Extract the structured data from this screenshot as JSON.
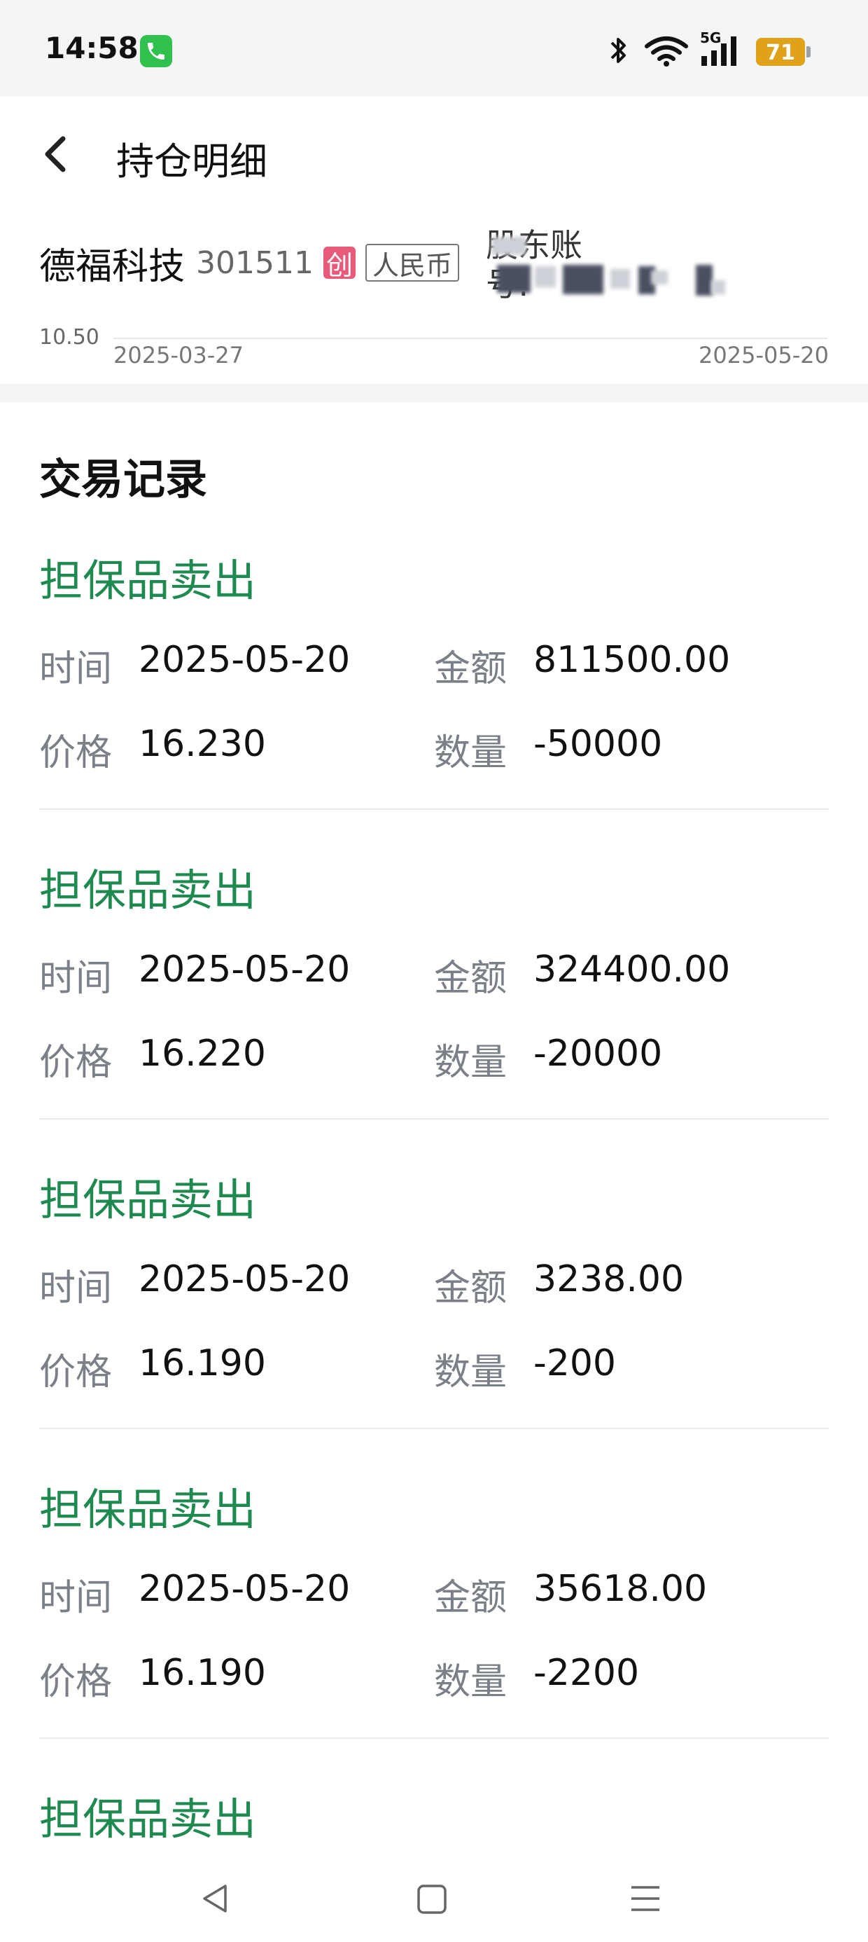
{
  "status_bar": {
    "time": "14:58",
    "network": "5G",
    "battery": "71"
  },
  "header": {
    "title": "持仓明细",
    "stock": {
      "name": "德福科技",
      "code": "301511",
      "board_badge": "创",
      "currency": "人民币",
      "account_label": "股东账",
      "account_number": "号:"
    },
    "chart": {
      "y_min_label": "10.50",
      "x_start": "2025-03-27",
      "x_end": "2025-05-20"
    }
  },
  "records_section": {
    "title": "交易记录",
    "labels": {
      "time": "时间",
      "amount": "金额",
      "price": "价格",
      "quantity": "数量"
    },
    "records": [
      {
        "type": "担保品卖出",
        "time": "2025-05-20",
        "amount": "811500.00",
        "price": "16.230",
        "quantity": "-50000"
      },
      {
        "type": "担保品卖出",
        "time": "2025-05-20",
        "amount": "324400.00",
        "price": "16.220",
        "quantity": "-20000"
      },
      {
        "type": "担保品卖出",
        "time": "2025-05-20",
        "amount": "3238.00",
        "price": "16.190",
        "quantity": "-200"
      },
      {
        "type": "担保品卖出",
        "time": "2025-05-20",
        "amount": "35618.00",
        "price": "16.190",
        "quantity": "-2200"
      },
      {
        "type": "担保品卖出"
      }
    ]
  },
  "colors": {
    "sell_green": "#1e8a50",
    "label_gray": "#7a7f88",
    "badge_red": "#e85a7a",
    "battery": "#e0a21b"
  },
  "nav_bar": {
    "icons": [
      "back-triangle-icon",
      "home-square-icon",
      "menu-lines-icon"
    ]
  }
}
